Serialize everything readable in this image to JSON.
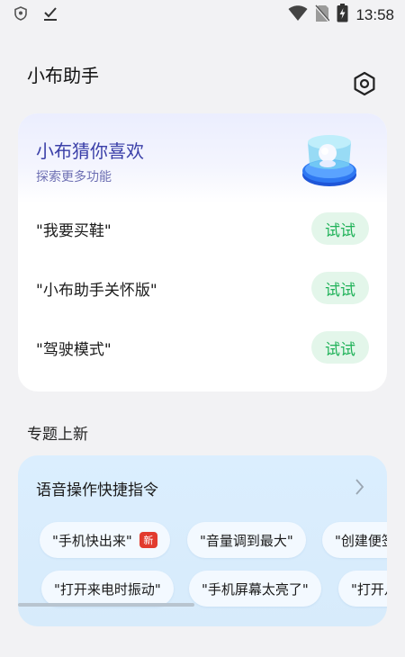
{
  "status_bar": {
    "time": "13:58",
    "icons": [
      "shield-icon",
      "download-done-icon",
      "wifi-icon",
      "no-sim-icon",
      "battery-icon"
    ]
  },
  "app": {
    "title": "小布助手",
    "settings_icon": "settings-icon"
  },
  "guess_card": {
    "title": "小布猜你喜欢",
    "subtitle": "探索更多功能",
    "items": [
      {
        "text": "\"我要买鞋\"",
        "button": "试试"
      },
      {
        "text": "\"小布助手关怀版\"",
        "button": "试试"
      },
      {
        "text": "\"驾驶模式\"",
        "button": "试试"
      }
    ]
  },
  "section": {
    "title": "专题上新"
  },
  "voice_card": {
    "title": "语音操作快捷指令",
    "row1": [
      {
        "text": "\"手机快出来\"",
        "badge": "新"
      },
      {
        "text": "\"音量调到最大\""
      },
      {
        "text": "\"创建便签"
      }
    ],
    "row2": [
      {
        "text": "\"打开来电时振动\""
      },
      {
        "text": "\"手机屏幕太亮了\""
      },
      {
        "text": "\"打开八"
      }
    ]
  },
  "colors": {
    "accent_green": "#20b259",
    "title_purple": "#3a3fa8",
    "badge_red": "#e23b2e"
  }
}
